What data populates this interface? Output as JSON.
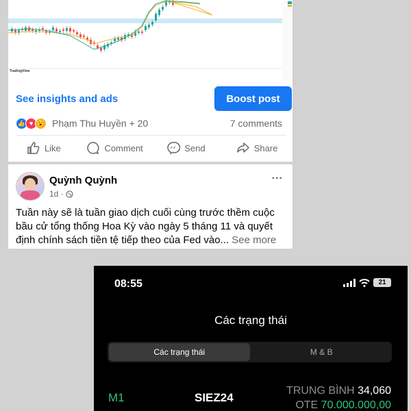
{
  "chart_post": {
    "watermark": "TradingView"
  },
  "post1": {
    "insights_label": "See insights and ads",
    "boost_label": "Boost post",
    "reaction_names": "Phạm Thu Huyền + 20",
    "comments_count": "7 comments",
    "actions": {
      "like": "Like",
      "comment": "Comment",
      "send": "Send",
      "share": "Share"
    }
  },
  "post2": {
    "author": "Quỳnh Quỳnh",
    "time": "1d ·",
    "text": "Tuần này sẽ là tuần giao dịch cuối cùng trước thềm cuộc bầu cử tổng thống Hoa Kỳ vào ngày 5 tháng 11 và quyết định chính sách tiền tệ tiếp theo của Fed vào...",
    "see_more": "See more",
    "more_icon": "..."
  },
  "phone": {
    "time": "08:55",
    "battery": "21",
    "title": "Các trạng thái",
    "tabs": [
      "Các trạng thái",
      "M & B"
    ],
    "row": {
      "label": "M1",
      "symbol": "SIEZ24",
      "avg_label": "TRUNG BÌNH",
      "avg_value": "34,060",
      "ote_label": "OTE",
      "ote_value": "70.000.000,00"
    }
  },
  "colors": {
    "facebook_blue": "#1877f2",
    "positive_green": "#2ec27e"
  }
}
